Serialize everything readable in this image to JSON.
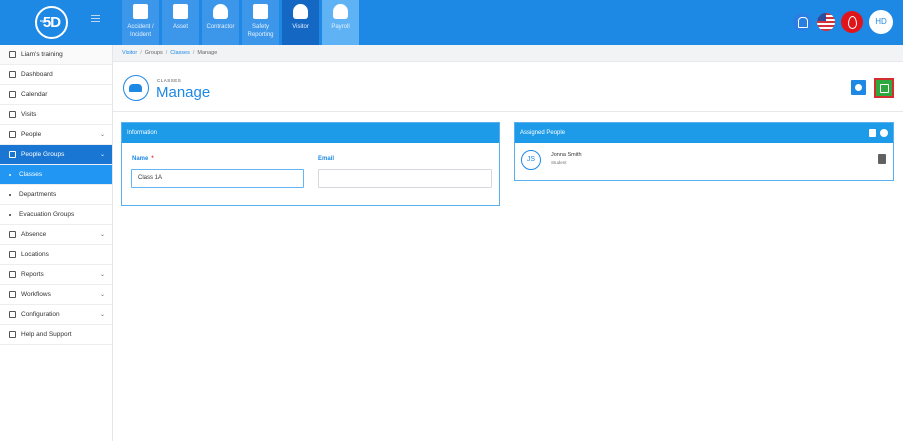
{
  "logo": {
    "text": "5D",
    "mini": "cgi"
  },
  "modules": [
    {
      "label": "Accident / Incident",
      "state": "normal"
    },
    {
      "label": "Asset",
      "state": "normal"
    },
    {
      "label": "Contractor",
      "state": "normal"
    },
    {
      "label": "Safety Reporting",
      "state": "normal"
    },
    {
      "label": "Visitor",
      "state": "active"
    },
    {
      "label": "Payroll",
      "state": "light"
    }
  ],
  "user": {
    "initials": "HD"
  },
  "sidebar": {
    "items": [
      {
        "label": "Liam's training",
        "icon": "branch-icon"
      },
      {
        "label": "Dashboard",
        "icon": "dashboard-icon"
      },
      {
        "label": "Calendar",
        "icon": "calendar-icon"
      },
      {
        "label": "Visits",
        "icon": "visits-icon"
      },
      {
        "label": "People",
        "icon": "people-icon",
        "chevron": "⌄"
      },
      {
        "label": "People Groups",
        "icon": "people-groups-icon",
        "chevron": "⌄"
      },
      {
        "label": "Classes",
        "child": true
      },
      {
        "label": "Departments",
        "child": true
      },
      {
        "label": "Evacuation Groups",
        "child": true
      },
      {
        "label": "Absence",
        "icon": "absence-icon",
        "chevron": "⌄"
      },
      {
        "label": "Locations",
        "icon": "locations-icon"
      },
      {
        "label": "Reports",
        "icon": "reports-icon",
        "chevron": "⌄"
      },
      {
        "label": "Workflows",
        "icon": "workflows-icon",
        "chevron": "⌄"
      },
      {
        "label": "Configuration",
        "icon": "configuration-icon",
        "chevron": "⌄"
      },
      {
        "label": "Help and Support",
        "icon": "help-icon"
      }
    ]
  },
  "breadcrumb": {
    "item1": "Visitor",
    "item2": "Groups",
    "item3": "Classes",
    "item4": "Manage",
    "sep": "/"
  },
  "page": {
    "section": "CLASSES",
    "title": "Manage"
  },
  "info_panel": {
    "title": "Information",
    "name_label": "Name",
    "required_mark": "*",
    "name_value": "Class 1A",
    "email_label": "Email",
    "email_value": ""
  },
  "assigned_panel": {
    "title": "Assigned People",
    "people": [
      {
        "initials": "JS",
        "name": "Jonna Smith",
        "role": "Student"
      }
    ]
  },
  "colors": {
    "primary": "#1e88e5",
    "save": "#2ea73f",
    "alert": "#e0151b"
  }
}
